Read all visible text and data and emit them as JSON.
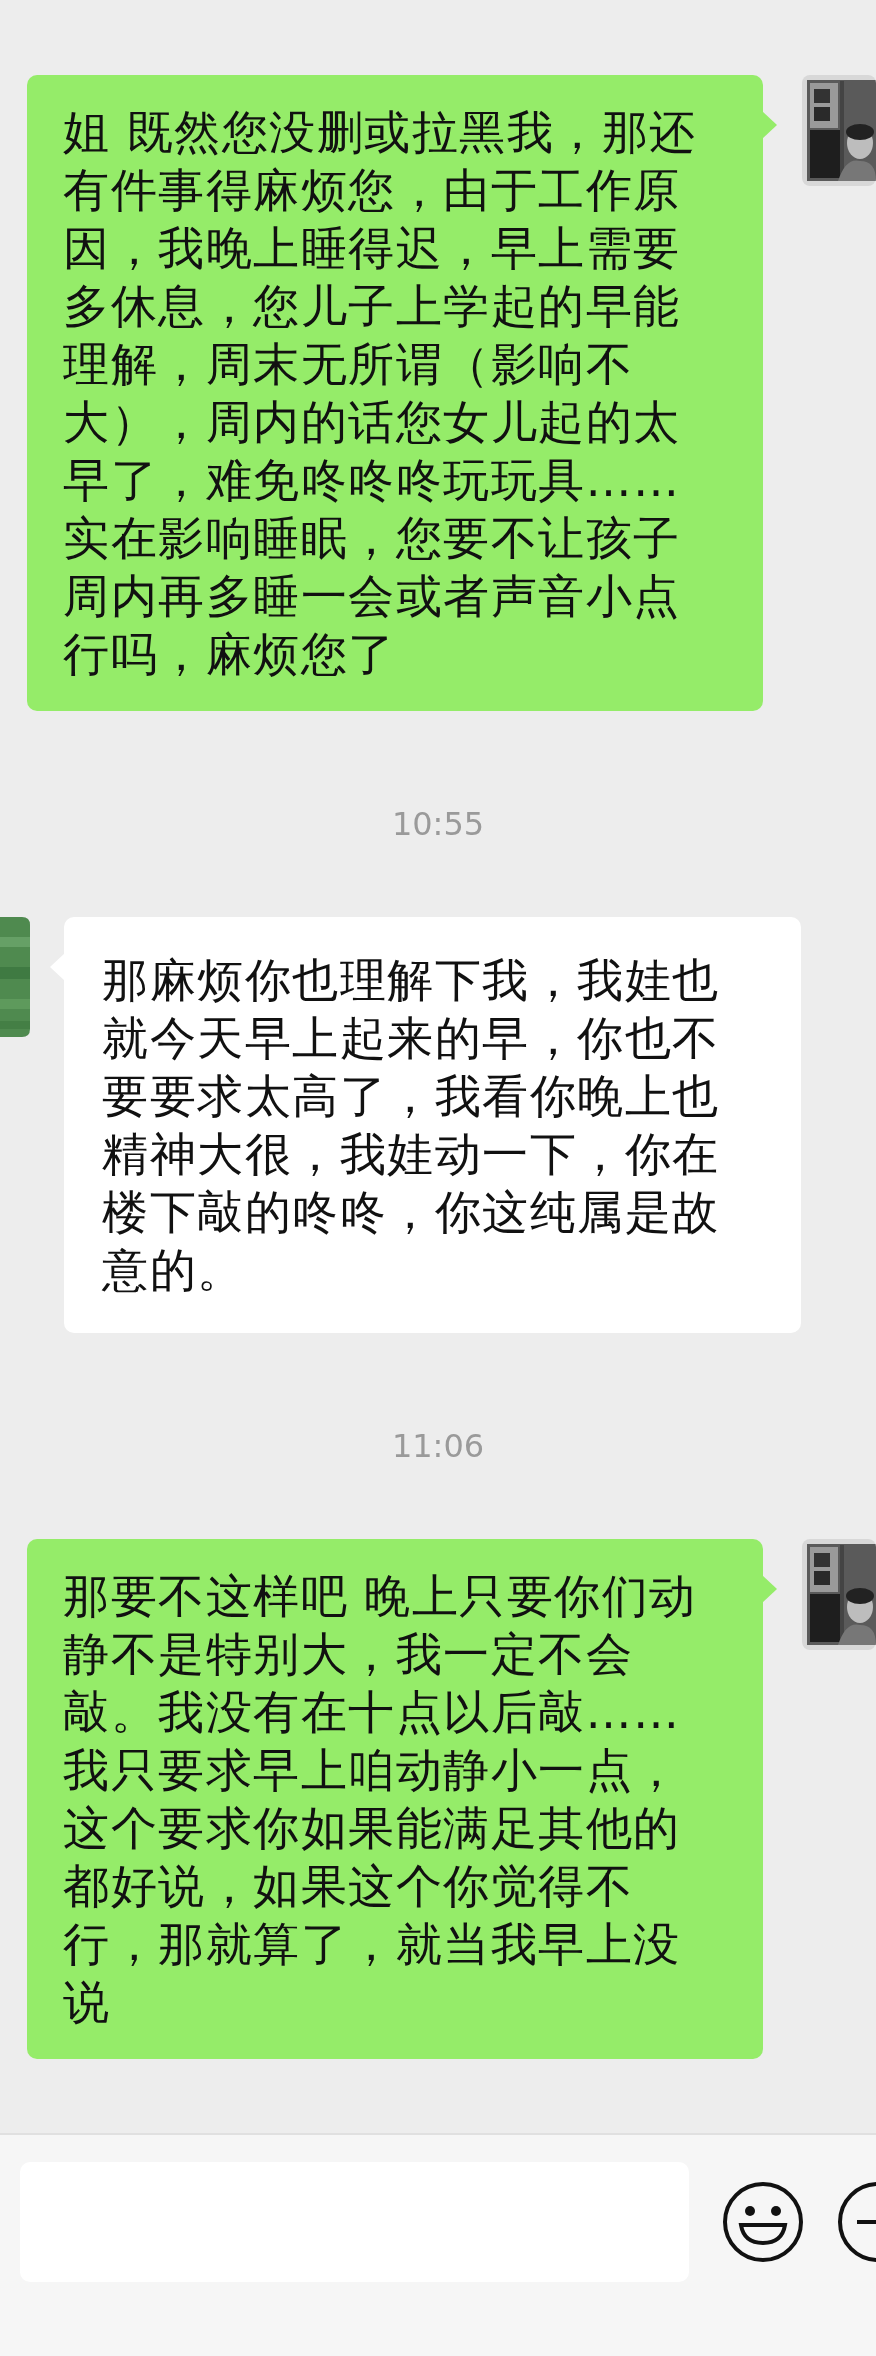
{
  "messages": [
    {
      "kind": "message",
      "outgoing": true,
      "text": "姐 既然您没删或拉黑我，那还有件事得麻烦您，由于工作原因，我晚上睡得迟，早上需要多休息，您儿子上学起的早能理解，周末无所谓（影响不大），周内的话您女儿起的太早了，难免咚咚咚玩玩具……实在影响睡眠，您要不让孩子周内再多睡一会或者声音小点行吗，麻烦您了"
    },
    {
      "kind": "time",
      "text": "10:55"
    },
    {
      "kind": "message",
      "outgoing": false,
      "text": "那麻烦你也理解下我，我娃也就今天早上起来的早，你也不要要求太高了，我看你晚上也精神大很，我娃动一下，你在楼下敲的咚咚，你这纯属是故意的。"
    },
    {
      "kind": "time",
      "text": "11:06"
    },
    {
      "kind": "message",
      "outgoing": true,
      "text": "那要不这样吧 晚上只要你们动静不是特别大，我一定不会敲。我没有在十点以后敲……  我只要求早上咱动静小一点，这个要求你如果能满足其他的都好说，如果这个你觉得不行，那就算了，就当我早上没说"
    }
  ]
}
